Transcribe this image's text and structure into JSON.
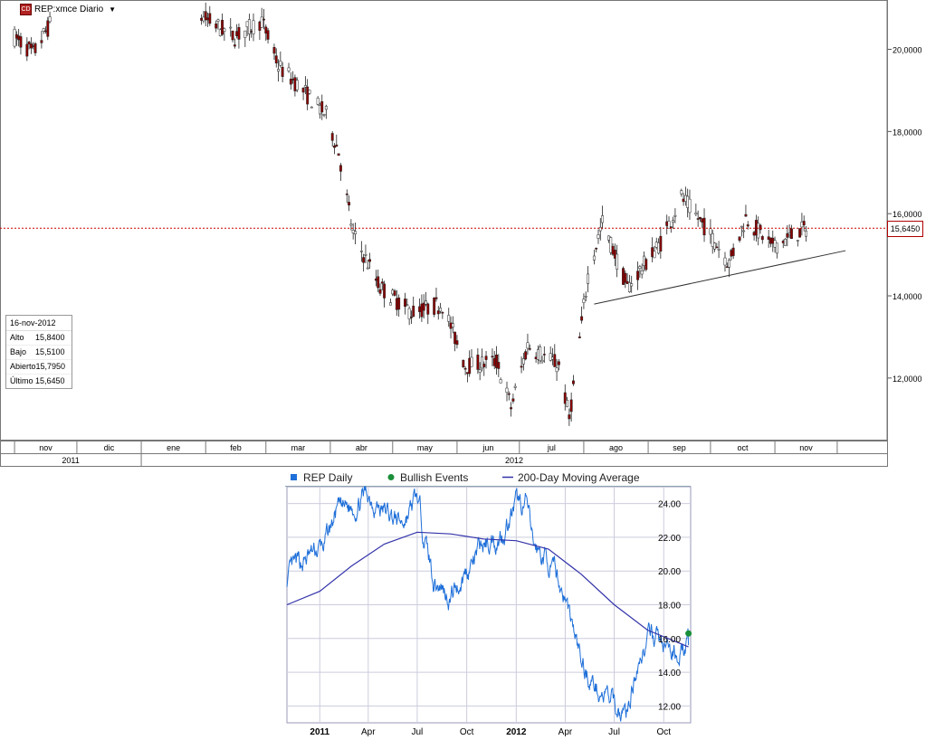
{
  "toolbar": {
    "symbol_label": "REP:xmce Diario",
    "icon_text": "CD"
  },
  "ohlc_box": {
    "date": "16-nov-2012",
    "rows": [
      {
        "label": "Alto",
        "value": "15,8400"
      },
      {
        "label": "Bajo",
        "value": "15,5100"
      },
      {
        "label": "Abierto",
        "value": "15,7950"
      },
      {
        "label": "Último",
        "value": "15,6450"
      }
    ]
  },
  "current_price_label": "15,6450",
  "chart_data": [
    {
      "type": "candlestick",
      "title": "REP:xmce Diario",
      "y_tick_labels": [
        "12,0000",
        "14,0000",
        "16,0000",
        "18,0000",
        "20,0000"
      ],
      "y_ticks": [
        12,
        14,
        16,
        18,
        20
      ],
      "ylim": [
        10.5,
        21.2
      ],
      "x_month_labels": [
        "nov",
        "dic",
        "ene",
        "feb",
        "mar",
        "abr",
        "may",
        "jun",
        "jul",
        "ago",
        "sep",
        "oct",
        "nov"
      ],
      "x_year_labels": [
        "2011",
        "2012"
      ],
      "current_price": 15.645,
      "trendline": {
        "from": [
          "2012-08-06",
          13.8
        ],
        "to": [
          "2012-12-05",
          15.1
        ]
      },
      "colors": {
        "up": "#ffffff",
        "down": "#8b0000",
        "price_line": "#cc0000",
        "trendline": "#333333"
      },
      "monthly_closes": [
        {
          "date": "2011-11-01",
          "value": 20.3
        },
        {
          "date": "2011-11-10",
          "value": 19.9
        },
        {
          "date": "2011-11-18",
          "value": 20.6
        },
        {
          "date": "2012-01-30",
          "value": 20.8
        },
        {
          "date": "2012-02-15",
          "value": 20.3
        },
        {
          "date": "2012-02-28",
          "value": 20.7
        },
        {
          "date": "2012-03-07",
          "value": 19.6
        },
        {
          "date": "2012-03-15",
          "value": 19.2
        },
        {
          "date": "2012-03-30",
          "value": 18.4
        },
        {
          "date": "2012-04-05",
          "value": 17.5
        },
        {
          "date": "2012-04-12",
          "value": 15.5
        },
        {
          "date": "2012-04-25",
          "value": 14.2
        },
        {
          "date": "2012-05-10",
          "value": 13.6
        },
        {
          "date": "2012-05-25",
          "value": 13.8
        },
        {
          "date": "2012-06-05",
          "value": 12.3
        },
        {
          "date": "2012-06-20",
          "value": 12.4
        },
        {
          "date": "2012-06-27",
          "value": 11.3
        },
        {
          "date": "2012-07-05",
          "value": 12.8
        },
        {
          "date": "2012-07-20",
          "value": 12.3
        },
        {
          "date": "2012-07-25",
          "value": 11.0
        },
        {
          "date": "2012-08-03",
          "value": 14.5
        },
        {
          "date": "2012-08-10",
          "value": 15.8
        },
        {
          "date": "2012-08-22",
          "value": 14.2
        },
        {
          "date": "2012-09-07",
          "value": 15.3
        },
        {
          "date": "2012-09-17",
          "value": 16.4
        },
        {
          "date": "2012-09-28",
          "value": 15.7
        },
        {
          "date": "2012-10-10",
          "value": 14.8
        },
        {
          "date": "2012-10-18",
          "value": 15.9
        },
        {
          "date": "2012-10-31",
          "value": 15.2
        },
        {
          "date": "2012-11-16",
          "value": 15.645
        }
      ]
    },
    {
      "type": "line",
      "legend": [
        "REP Daily",
        "Bullish Events",
        "200-Day Moving Average"
      ],
      "legend_colors": [
        "#1e6fd9",
        "#1a8f3a",
        "#3333aa"
      ],
      "y_tick_labels": [
        "12.00",
        "14.00",
        "16.00",
        "18.00",
        "20.00",
        "22.00",
        "24.00"
      ],
      "y_ticks": [
        12,
        14,
        16,
        18,
        20,
        22,
        24
      ],
      "ylim": [
        11,
        25
      ],
      "x_tick_labels": [
        "2011",
        "Apr",
        "Jul",
        "Oct",
        "2012",
        "Apr",
        "Jul",
        "Oct"
      ],
      "grid": true,
      "series": [
        {
          "name": "REP Daily",
          "points": [
            {
              "date": "2010-11-01",
              "value": 19.5
            },
            {
              "date": "2010-12-01",
              "value": 20.5
            },
            {
              "date": "2011-01-10",
              "value": 21.5
            },
            {
              "date": "2011-02-01",
              "value": 23.5
            },
            {
              "date": "2011-03-01",
              "value": 23.8
            },
            {
              "date": "2011-04-01",
              "value": 24.6
            },
            {
              "date": "2011-05-01",
              "value": 23.5
            },
            {
              "date": "2011-06-01",
              "value": 22.8
            },
            {
              "date": "2011-07-01",
              "value": 24.2
            },
            {
              "date": "2011-08-01",
              "value": 19.5
            },
            {
              "date": "2011-09-01",
              "value": 18.5
            },
            {
              "date": "2011-10-01",
              "value": 20.0
            },
            {
              "date": "2011-11-01",
              "value": 21.5
            },
            {
              "date": "2011-12-01",
              "value": 22.0
            },
            {
              "date": "2012-01-01",
              "value": 23.8
            },
            {
              "date": "2012-01-20",
              "value": 24.0
            },
            {
              "date": "2012-02-01",
              "value": 21.5
            },
            {
              "date": "2012-03-01",
              "value": 20.5
            },
            {
              "date": "2012-04-01",
              "value": 18.5
            },
            {
              "date": "2012-05-01",
              "value": 14.5
            },
            {
              "date": "2012-06-01",
              "value": 13.0
            },
            {
              "date": "2012-07-01",
              "value": 12.0
            },
            {
              "date": "2012-07-25",
              "value": 11.5
            },
            {
              "date": "2012-08-15",
              "value": 15.0
            },
            {
              "date": "2012-09-15",
              "value": 16.2
            },
            {
              "date": "2012-10-15",
              "value": 15.0
            },
            {
              "date": "2012-11-16",
              "value": 15.6
            }
          ]
        },
        {
          "name": "200-Day Moving Average",
          "points": [
            {
              "date": "2010-11-01",
              "value": 18.0
            },
            {
              "date": "2011-01-01",
              "value": 18.8
            },
            {
              "date": "2011-03-01",
              "value": 20.3
            },
            {
              "date": "2011-05-01",
              "value": 21.6
            },
            {
              "date": "2011-07-01",
              "value": 22.3
            },
            {
              "date": "2011-09-01",
              "value": 22.2
            },
            {
              "date": "2011-11-01",
              "value": 21.9
            },
            {
              "date": "2012-01-01",
              "value": 21.8
            },
            {
              "date": "2012-03-01",
              "value": 21.3
            },
            {
              "date": "2012-05-01",
              "value": 19.8
            },
            {
              "date": "2012-07-01",
              "value": 18.0
            },
            {
              "date": "2012-09-01",
              "value": 16.5
            },
            {
              "date": "2012-11-16",
              "value": 15.5
            }
          ]
        },
        {
          "name": "Bullish Events",
          "points": [
            {
              "date": "2012-11-16",
              "value": 16.3
            }
          ]
        }
      ]
    }
  ]
}
